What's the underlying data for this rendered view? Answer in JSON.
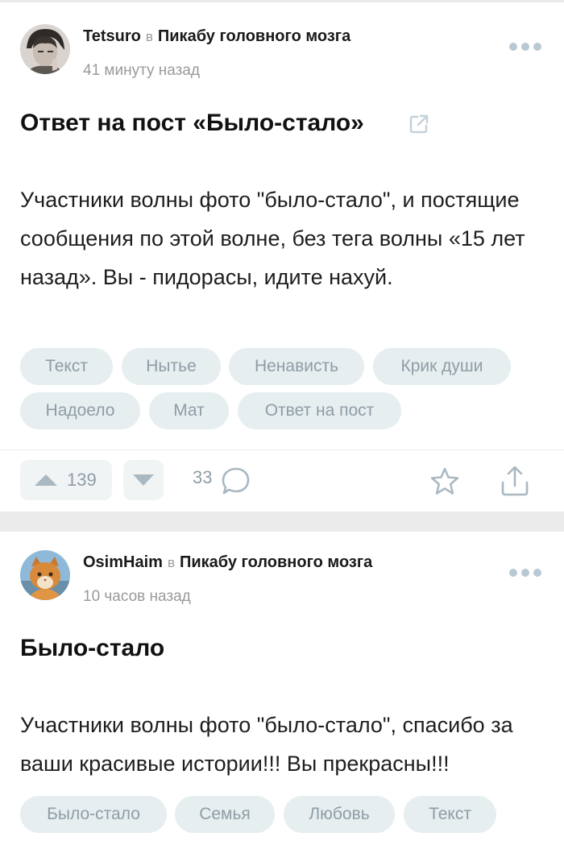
{
  "posts": [
    {
      "author": "Tetsuro",
      "in_word": "в",
      "community": "Пикабу головного мозга",
      "time": "41 минуту назад",
      "title": "Ответ на пост «Было-стало»",
      "body": "Участники волны фото \"было-стало\", и постящие сообщения по этой волне, без тега волны «15 лет назад». Вы - пидорасы, идите нахуй.",
      "tags": [
        "Текст",
        "Нытье",
        "Ненависть",
        "Крик души",
        "Надоело",
        "Мат",
        "Ответ на пост"
      ],
      "rating": "139",
      "comments": "33"
    },
    {
      "author": "OsimHaim",
      "in_word": "в",
      "community": "Пикабу головного мозга",
      "time": "10 часов назад",
      "title": "Было-стало",
      "body": "Участники волны фото \"было-стало\", спасибо за ваши красивые истории!!! Вы прекрасны!!!",
      "tags": [
        "Было-стало",
        "Семья",
        "Любовь",
        "Текст"
      ]
    }
  ],
  "icons": {
    "more": "more-dots-icon",
    "external": "external-link-icon",
    "upvote": "upvote-triangle-icon",
    "downvote": "downvote-triangle-icon",
    "comment": "comment-bubble-icon",
    "save": "star-icon",
    "share": "share-icon"
  },
  "colors": {
    "tag_bg": "#e6eef0",
    "tag_text": "#8f9da6",
    "meta_text": "#9a9a9a",
    "divider": "#ebebeb"
  }
}
